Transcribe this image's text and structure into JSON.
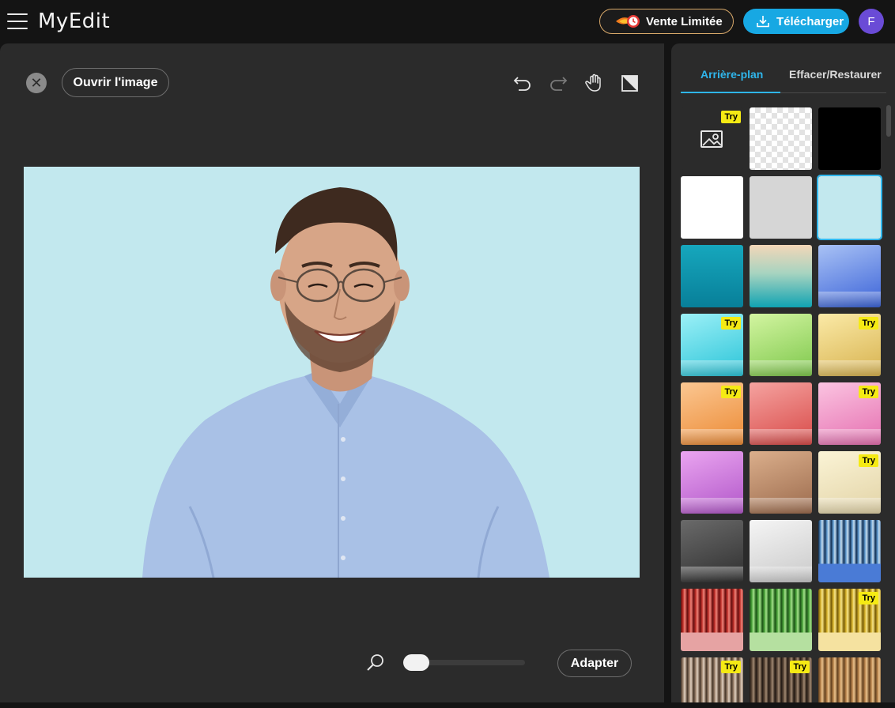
{
  "app": {
    "logo": "MyEdit",
    "sale_label": "Vente Limitée",
    "download_label": "Télécharger",
    "avatar_initial": "F"
  },
  "editor": {
    "open_image_label": "Ouvrir l'image",
    "fit_label": "Adapter",
    "zoom_level": 0.1
  },
  "panel": {
    "tabs": [
      {
        "label": "Arrière-plan",
        "active": true
      },
      {
        "label": "Effacer/Restaurer",
        "active": false
      }
    ],
    "try_label": "Try",
    "swatches": [
      {
        "name": "upload-image",
        "try": true
      },
      {
        "name": "transparent",
        "try": false
      },
      {
        "name": "black",
        "color": "#000000",
        "try": false
      },
      {
        "name": "white",
        "color": "#ffffff",
        "try": false
      },
      {
        "name": "light-gray",
        "color": "#d6d6d6",
        "try": false
      },
      {
        "name": "light-cyan",
        "color": "#c2e8ee",
        "try": false,
        "selected": true
      },
      {
        "name": "teal",
        "try": false
      },
      {
        "name": "peach-teal",
        "try": false
      },
      {
        "name": "blue-room",
        "try": false
      },
      {
        "name": "cyan-room",
        "try": true
      },
      {
        "name": "green-room",
        "try": false
      },
      {
        "name": "yellow-room",
        "try": true
      },
      {
        "name": "orange-room",
        "try": true
      },
      {
        "name": "red-room",
        "try": false
      },
      {
        "name": "pink-room",
        "try": true
      },
      {
        "name": "purple-room",
        "try": false
      },
      {
        "name": "brown-room",
        "try": false
      },
      {
        "name": "cream-room",
        "try": true
      },
      {
        "name": "dark-gray-room",
        "try": false
      },
      {
        "name": "white-room",
        "try": false
      },
      {
        "name": "blue-curtain",
        "try": false
      },
      {
        "name": "red-curtain",
        "try": false
      },
      {
        "name": "green-curtain",
        "try": false
      },
      {
        "name": "gold-curtain",
        "try": true
      },
      {
        "name": "wood-curtain-1",
        "try": true
      },
      {
        "name": "wood-curtain-2",
        "try": true
      },
      {
        "name": "wood-curtain-3",
        "try": false
      }
    ]
  },
  "colors": {
    "accent": "#17a8e3",
    "tab_active": "#2fb6ec",
    "canvas_bg": "#c2e8ee",
    "try_badge": "#f5ea14"
  }
}
